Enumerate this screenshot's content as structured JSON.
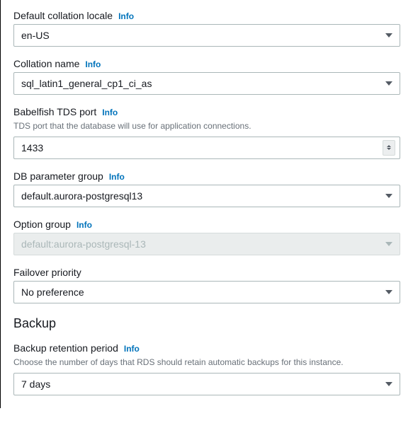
{
  "common": {
    "info": "Info"
  },
  "fields": {
    "collation_locale": {
      "label": "Default collation locale",
      "value": "en-US"
    },
    "collation_name": {
      "label": "Collation name",
      "value": "sql_latin1_general_cp1_ci_as"
    },
    "tds_port": {
      "label": "Babelfish TDS port",
      "help": "TDS port that the database will use for application connections.",
      "value": "1433"
    },
    "parameter_group": {
      "label": "DB parameter group",
      "value": "default.aurora-postgresql13"
    },
    "option_group": {
      "label": "Option group",
      "value": "default:aurora-postgresql-13"
    },
    "failover_priority": {
      "label": "Failover priority",
      "value": "No preference"
    },
    "backup_retention": {
      "label": "Backup retention period",
      "help": "Choose the number of days that RDS should retain automatic backups for this instance.",
      "value": "7 days"
    }
  },
  "sections": {
    "backup": "Backup"
  }
}
